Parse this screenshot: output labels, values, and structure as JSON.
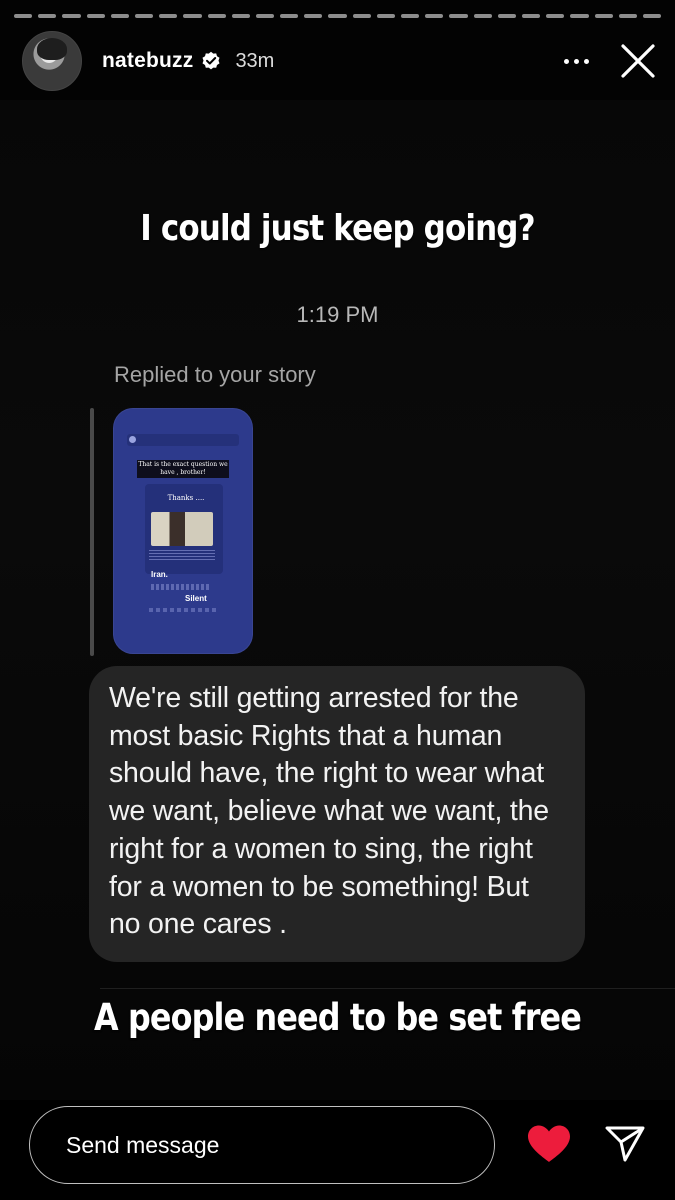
{
  "header": {
    "username": "natebuzz",
    "time_ago": "33m",
    "verified_icon": "verified-badge-icon",
    "more_icon": "more-options-icon",
    "close_icon": "close-icon"
  },
  "story": {
    "overlay_top": "I could just keep going?",
    "overlay_bottom": "A people need to be set free",
    "dm": {
      "timestamp": "1:19 PM",
      "replied_label": "Replied to your story",
      "story_preview": {
        "quote": "That is the exact question we have , brother!",
        "thanks": "Thanks ....",
        "word1": "Iran.",
        "word2": "Silent"
      },
      "message": "We're still getting arrested for the most basic Rights that a human should have, the right to wear what we want, believe what we want, the right for a women to sing, the right for a women to be something! But no one cares ."
    }
  },
  "composer": {
    "placeholder": "Send message",
    "like_icon": "heart-icon",
    "share_icon": "send-icon",
    "accent": "#ed1c3c"
  }
}
